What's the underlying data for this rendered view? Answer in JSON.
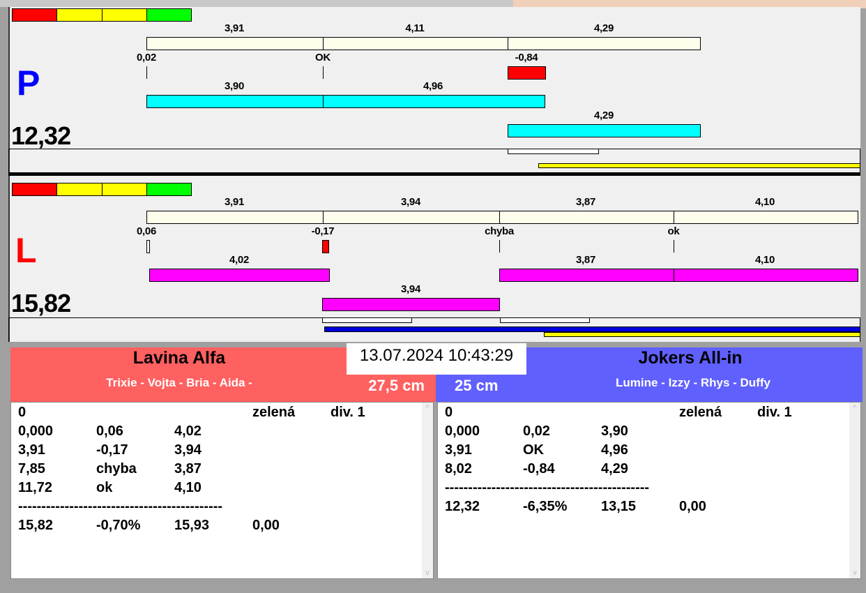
{
  "right_lane": {
    "letter": "P",
    "total": "12,32",
    "top_labels": [
      "3,91",
      "4,11",
      "4,29"
    ],
    "mid_labels": [
      "0,02",
      "OK",
      "-0,84"
    ],
    "bar_labels": [
      "3,90",
      "4,96",
      "4,29"
    ]
  },
  "left_lane": {
    "letter": "L",
    "total": "15,82",
    "top_labels": [
      "3,91",
      "3,94",
      "3,87",
      "4,10"
    ],
    "mid_labels": [
      "0,06",
      "-0,17",
      "chyba",
      "ok"
    ],
    "bar_labels": [
      "4,02",
      "3,87",
      "4,10",
      "3,94"
    ]
  },
  "datetime": "13.07.2024 10:43:29",
  "team_left": {
    "name": "Lavina Alfa",
    "members": "Trixie - Vojta - Bria - Aida -",
    "distance": "27,5 cm",
    "color": "#ff6060",
    "rows": [
      [
        "0",
        "",
        "",
        "zelená",
        "div. 1"
      ],
      [
        "0,000",
        "0,06",
        "4,02",
        "",
        ""
      ],
      [
        "3,91",
        "-0,17",
        "3,94",
        "",
        ""
      ],
      [
        "7,85",
        "chyba",
        "3,87",
        "",
        ""
      ],
      [
        "11,72",
        "ok",
        "4,10",
        "",
        ""
      ]
    ],
    "separator": "--------------------------------------------",
    "summary": [
      "15,82",
      "-0,70%",
      "15,93",
      "0,00"
    ]
  },
  "team_right": {
    "name": "Jokers All-in",
    "members": "Lumine - Izzy - Rhys - Duffy",
    "distance": "25 cm",
    "color": "#6060ff",
    "rows": [
      [
        "0",
        "",
        "",
        "zelená",
        "div. 1"
      ],
      [
        "0,000",
        "0,02",
        "3,90",
        "",
        ""
      ],
      [
        "3,91",
        "OK",
        "4,96",
        "",
        ""
      ],
      [
        "8,02",
        "-0,84",
        "4,29",
        "",
        ""
      ]
    ],
    "separator": "--------------------------------------------",
    "summary": [
      "12,32",
      "-6,35%",
      "13,15",
      "0,00"
    ]
  },
  "scroll": {
    "up": "^",
    "down": "v"
  }
}
